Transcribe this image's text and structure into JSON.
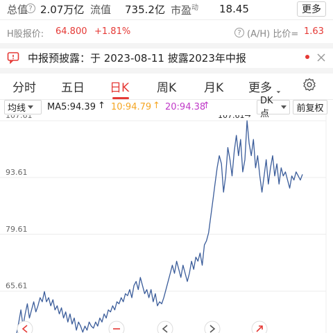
{
  "stats": {
    "total_label": "总值",
    "total_value": "2.07万亿",
    "float_label": "流值",
    "float_value": "735.2亿",
    "pe_label": "市盈",
    "pe_sup": "动",
    "pe_value": "18.45",
    "more_button": "更多"
  },
  "hshare": {
    "label": "H股报价:",
    "price": "64.800",
    "change": "+1.81%",
    "ratio_label": "(A/H) 比价=",
    "ratio_value": "1.63"
  },
  "notice": {
    "text": "中报预披露：于 2023-08-11 披露2023年中报"
  },
  "tabs": [
    {
      "label": "分时",
      "active": false
    },
    {
      "label": "五日",
      "active": false
    },
    {
      "label": "日K",
      "active": true
    },
    {
      "label": "周K",
      "active": false
    },
    {
      "label": "月K",
      "active": false
    },
    {
      "label": "更多",
      "active": false
    }
  ],
  "ma_row": {
    "type_label": "均线",
    "ma5": "MA5:94.39",
    "ma10": "10:94.79",
    "ma20": "20:94.38",
    "dk_label": "DK点",
    "adjust_label": "前复权"
  },
  "colors": {
    "accent": "#e53935",
    "line": "#3a5c9a",
    "ma10": "#f5a623",
    "ma20": "#c03ac8"
  },
  "chart_data": {
    "type": "line",
    "y_ticks": [
      "107.61",
      "93.61",
      "79.61",
      "65.61"
    ],
    "ylim": [
      55.3,
      107.61
    ],
    "max_annotation": "107.61",
    "values": [
      55.2,
      58,
      61,
      57,
      60,
      62.5,
      59,
      61,
      63,
      60.5,
      62,
      64,
      63,
      65.5,
      63,
      64,
      62,
      63.5,
      61,
      62,
      60,
      61.5,
      59,
      60.5,
      58,
      60,
      57.5,
      59,
      56,
      58,
      57,
      55.5,
      57,
      56,
      58,
      57,
      56.5,
      58,
      57,
      59,
      58,
      60,
      59,
      61,
      60.5,
      62,
      61,
      63,
      62.5,
      64,
      63,
      65,
      64.5,
      66,
      64,
      67,
      68,
      66,
      69,
      67,
      65,
      66,
      64,
      66,
      63,
      65,
      62,
      63,
      62.5,
      64,
      66,
      68,
      70,
      72,
      70,
      73,
      71,
      69,
      72,
      70,
      68,
      70,
      73,
      71,
      74,
      73,
      75,
      72,
      77,
      78,
      80,
      84,
      88,
      92,
      96,
      99,
      97,
      90,
      94,
      101,
      98,
      94,
      100,
      104,
      99,
      103,
      95,
      98,
      107.61,
      102,
      99,
      103,
      96,
      99,
      94,
      90,
      94,
      98,
      92,
      96,
      99,
      94,
      97,
      92,
      96,
      94,
      95,
      93,
      91,
      94,
      93,
      95,
      94,
      93,
      94.39
    ]
  }
}
